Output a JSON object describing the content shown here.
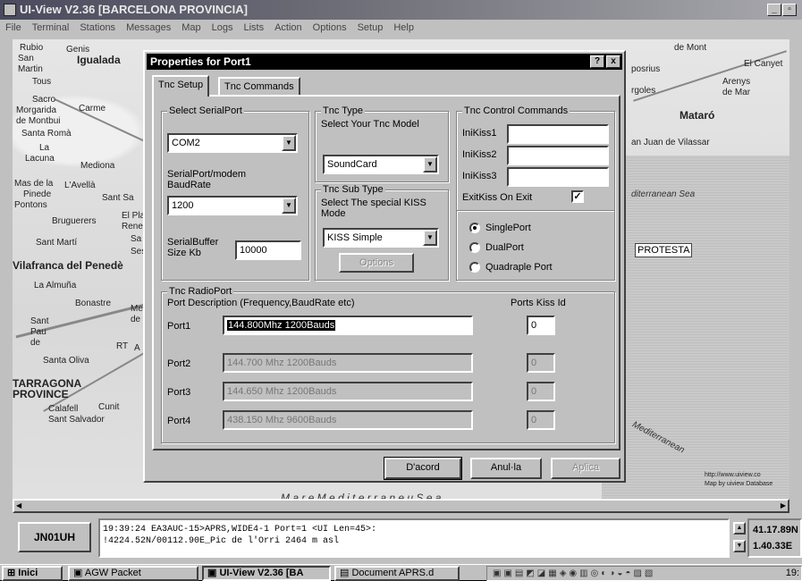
{
  "window": {
    "title": "UI-View V2.36 [BARCELONA PROVINCIA]",
    "controls": {
      "minimize": "_",
      "maximize": "▫"
    }
  },
  "menu": [
    "File",
    "Terminal",
    "Stations",
    "Messages",
    "Map",
    "Logs",
    "Lists",
    "Action",
    "Options",
    "Setup",
    "Help"
  ],
  "map": {
    "labels": {
      "top_left": [
        "Rubio",
        "Genis",
        "San",
        "Martin",
        "Igualada",
        "Tous",
        "Sacro",
        "Morgarida",
        "Carme",
        "de Montbui",
        "Santa Romà",
        "La",
        "Lacuna",
        "Mediona",
        "Mas de la",
        "Pinede",
        "Pontons",
        "L'Avellà",
        "Sant Sa",
        "Bruguerers",
        "El Pla",
        "Renec",
        "Sant Martí",
        "Sa",
        "Seso",
        "Vilafranca del Penedè",
        "La Almuña",
        "Bonastre",
        "Sant",
        "Pau",
        "de",
        "Santa Oliva",
        "TARRAGONA",
        "PROVINCE",
        "Cunit",
        "Calafell",
        "Sant Salvador",
        "Me",
        "de",
        "A",
        "RT"
      ],
      "right": [
        "de Mont",
        "El Canyet",
        "Arenys",
        "de Mar",
        "posrius",
        "rgoles",
        "Mataró",
        "an Juan de Vilassar",
        "diterranean Sea",
        "PROTESTA",
        "http://www.uiview.co",
        "Map by uiview Database",
        "Mediterranean"
      ],
      "bottom": "M a r e   M e d i t e r r a n e u   S e a"
    },
    "station_label": "PROTESTA"
  },
  "dialog": {
    "title": "Properties for Port1",
    "controls": {
      "help": "?",
      "close": "x"
    },
    "tabs": [
      "Tnc Setup",
      "Tnc Commands"
    ],
    "serial": {
      "title": "Select SerialPort",
      "port_value": "COM2",
      "baud_label": "SerialPort/modem BaudRate",
      "baud_value": "1200",
      "buffer_label": "SerialBuffer Size Kb",
      "buffer_value": "10000"
    },
    "tnc_type": {
      "title": "Tnc Type",
      "caption": "Select Your Tnc Model",
      "value": "SoundCard"
    },
    "tnc_subtype": {
      "title": "Tnc Sub Type",
      "caption": "Select The special KISS Mode",
      "value": "KISS Simple",
      "options_button": "Options"
    },
    "tnc_control": {
      "title": "Tnc Control Commands",
      "initkiss1": "IniKiss1",
      "initkiss2": "IniKiss2",
      "initkiss3": "IniKiss3",
      "exit_label": "ExitKiss On Exit",
      "exit_checked": "✓"
    },
    "port_mode": {
      "options": [
        "SinglePort",
        "DualPort",
        "Quadraple Port"
      ],
      "selected": "SinglePort"
    },
    "radioports": {
      "title": "Tnc RadioPort",
      "desc_header": "Port Description (Frequency,BaudRate etc)",
      "kiss_header": "Ports Kiss Id",
      "rows": [
        {
          "label": "Port1",
          "desc": "144.800Mhz 1200Bauds",
          "kiss": "0"
        },
        {
          "label": "Port2",
          "desc": "144.700 Mhz 1200Bauds",
          "kiss": "0"
        },
        {
          "label": "Port3",
          "desc": "144.650 Mhz 1200Bauds",
          "kiss": "0"
        },
        {
          "label": "Port4",
          "desc": "438.150 Mhz 9600Bauds",
          "kiss": "0"
        }
      ]
    },
    "buttons": {
      "ok": "D'acord",
      "cancel": "Anul·la",
      "apply": "Aplica"
    }
  },
  "status": {
    "locator": "JN01UH",
    "log": [
      "19:39:24 EA3AUC-15>APRS,WIDE4-1 Port=1 <UI Len=45>:",
      "!4224.52N/00112.90E_Pic de l'Orri 2464 m asl"
    ],
    "lat": "41.17.89N",
    "lon": "1.40.33E"
  },
  "taskbar": {
    "start": "Inici",
    "tasks": [
      "AGW Packet",
      "UI-View V2.36 [BA",
      "Document APRS.d"
    ],
    "clock": "19:"
  }
}
